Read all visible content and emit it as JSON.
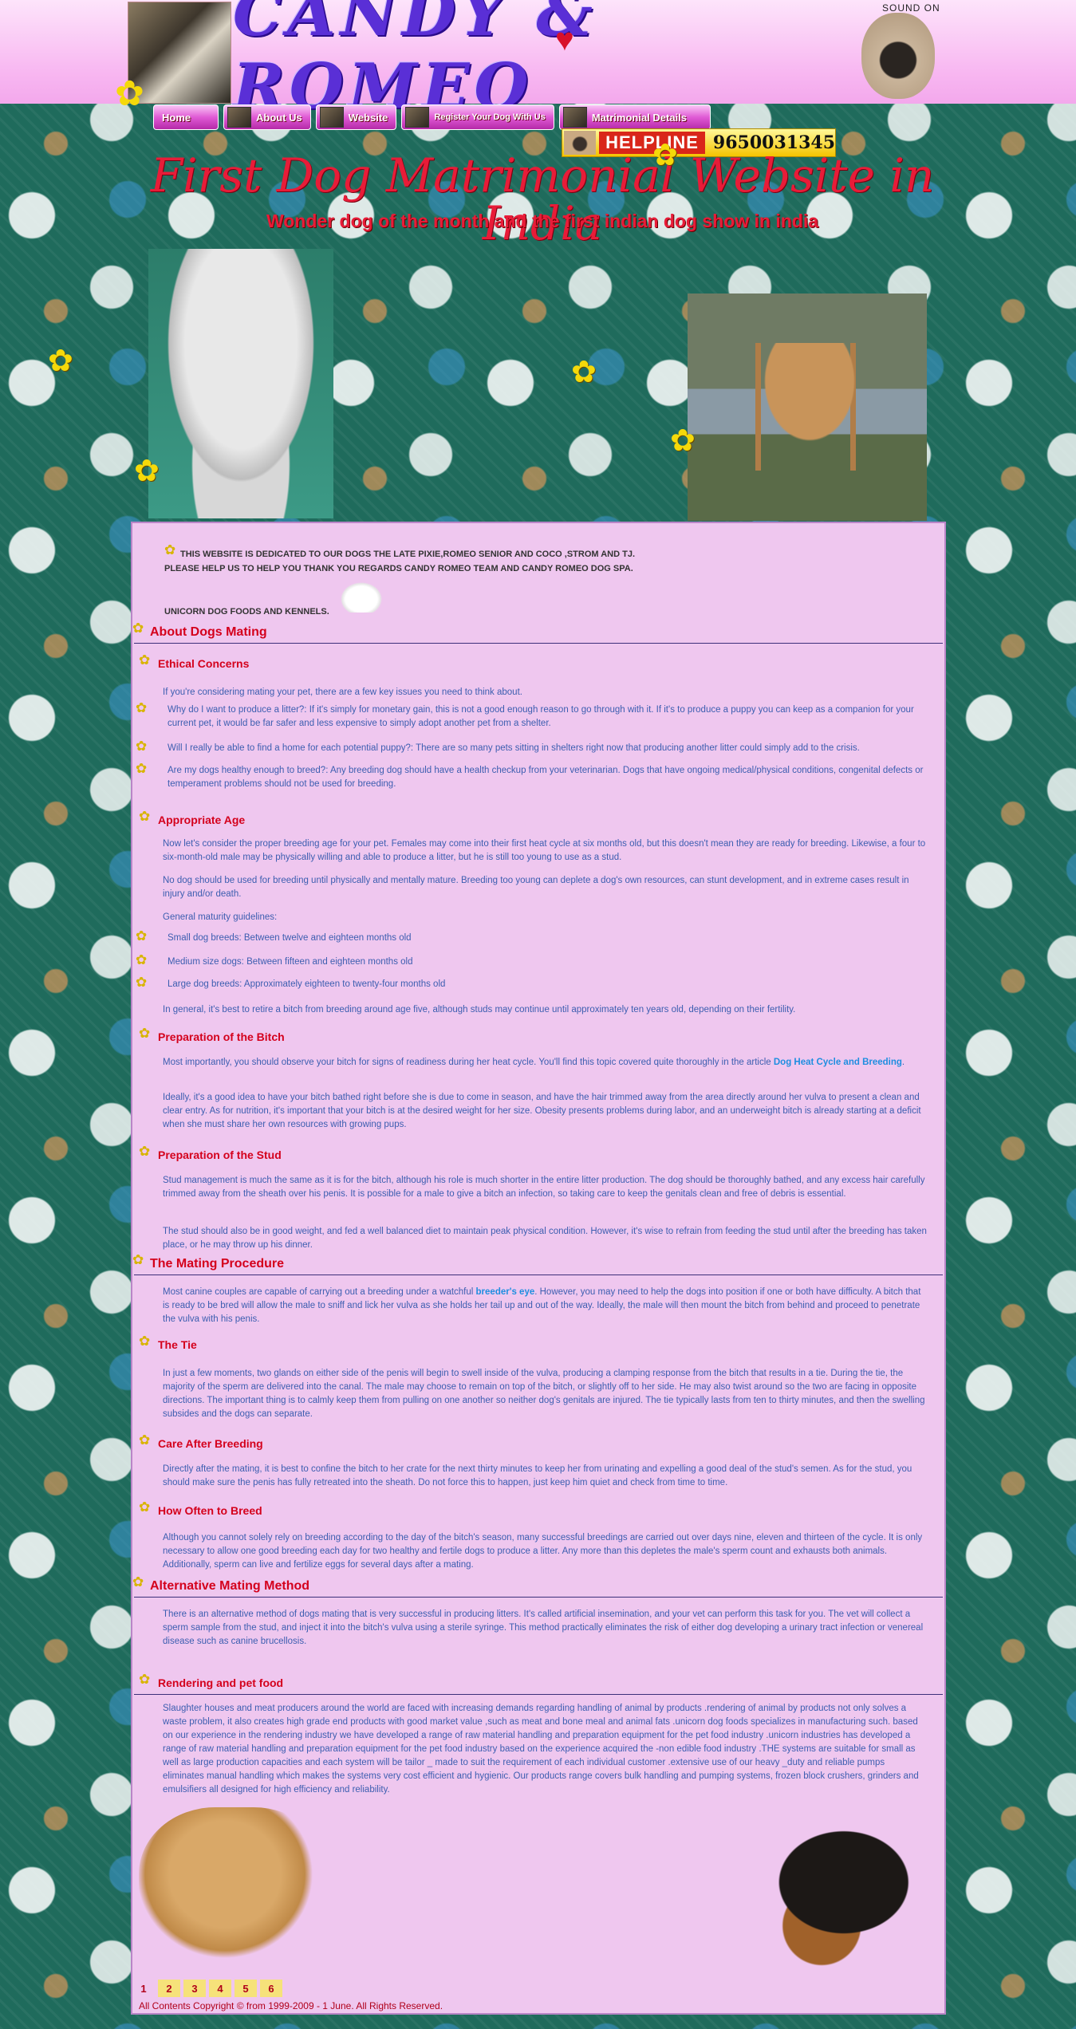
{
  "header": {
    "brand_text": "CANDY & ROMEO",
    "sound_label": "SOUND ON"
  },
  "nav": {
    "items": [
      {
        "label": "Home"
      },
      {
        "label": "About Us"
      },
      {
        "label": "Website"
      },
      {
        "label": "Register Your Dog With Us"
      },
      {
        "label": "Matrimonial Details"
      }
    ]
  },
  "helpline": {
    "label": "HELPLINE",
    "number": "9650031345"
  },
  "hero": {
    "title": "First Dog Matrimonial Website in India",
    "subtitle": "Wonder dog of the month and the first indian dog show in india"
  },
  "intro": {
    "line1": "THIS WEBSITE IS DEDICATED TO OUR DOGS THE LATE PIXIE,ROMEO SENIOR AND COCO ,STROM AND TJ.",
    "line2": "PLEASE HELP US TO HELP YOU THANK YOU REGARDS CANDY ROMEO TEAM AND CANDY ROMEO DOG SPA.",
    "line3": "UNICORN DOG FOODS AND KENNELS."
  },
  "sections": {
    "about_mating": "About Dogs Mating",
    "ethical": {
      "title": "Ethical Concerns",
      "intro": "If you're considering mating your pet, there are a few key issues you need to think about.",
      "q1": "Why do I want to produce a litter?: If it's simply for monetary gain, this is not a good enough reason to go through with it. If it's to produce a puppy you can keep as a companion for your current pet, it would be far safer and less expensive to simply adopt another pet from a shelter.",
      "q2": "Will I really be able to find a home for each potential puppy?: There are so many pets sitting in shelters right now that producing another litter could simply add to the crisis.",
      "q3": "Are my dogs healthy enough to breed?: Any breeding dog should have a health checkup from your veterinarian. Dogs that have ongoing medical/physical conditions, congenital defects or temperament problems should not be used for breeding."
    },
    "age": {
      "title": "Appropriate Age",
      "p1": "Now let's consider the proper breeding age for your pet. Females may come into their first heat cycle at six months old, but this doesn't mean they are ready for breeding. Likewise, a four to six-month-old male may be physically willing and able to produce a litter, but he is still too young to use as a stud.",
      "p2": "No dog should be used for breeding until physically and mentally mature. Breeding too young can deplete a dog's own resources, can stunt development, and in extreme cases result in injury and/or death.",
      "p3": "General maturity guidelines:",
      "g1": "Small dog breeds: Between twelve and eighteen months old",
      "g2": "Medium size dogs: Between fifteen and eighteen months old",
      "g3": "Large dog breeds: Approximately eighteen to twenty-four months old",
      "p4": "In general, it's best to retire a bitch from breeding around age five, although studs may continue until approximately ten years old, depending on their fertility."
    },
    "bitch": {
      "title": "Preparation of the Bitch",
      "p1_pre": "Most importantly, you should observe your bitch for signs of readiness during her heat cycle. You'll find this topic covered quite thoroughly in the article ",
      "p1_link": "Dog Heat Cycle and Breeding",
      "p1_post": ".",
      "p2": "Ideally, it's a good idea to have your bitch bathed right before she is due to come in season, and have the hair trimmed away from the area directly around her vulva to present a clean and clear entry. As for nutrition, it's important that your bitch is at the desired weight for her size. Obesity presents problems during labor, and an underweight bitch is already starting at a deficit when she must share her own resources with growing pups."
    },
    "stud": {
      "title": "Preparation of the Stud",
      "p1": "Stud management is much the same as it is for the bitch, although his role is much shorter in the entire litter production. The dog should be thoroughly bathed, and any excess hair carefully trimmed away from the sheath over his penis. It is possible for a male to give a bitch an infection, so taking care to keep the genitals clean and free of debris is essential.",
      "p2": "The stud should also be in good weight, and fed a well balanced diet to maintain peak physical condition. However, it's wise to refrain from feeding the stud until after the breeding has taken place, or he may throw up his dinner."
    },
    "procedure": {
      "title": "The Mating Procedure",
      "p1_pre": "Most canine couples are capable of carrying out a breeding under a watchful ",
      "p1_link": "breeder's eye",
      "p1_post": ". However, you may need to help the dogs into position if one or both have difficulty. A bitch that is ready to be bred will allow the male to sniff and lick her vulva as she holds her tail up and out of the way. Ideally, the male will then mount the bitch from behind and proceed to penetrate the vulva with his penis."
    },
    "tie": {
      "title": "The Tie",
      "p1": "In just a few moments, two glands on either side of the penis will begin to swell inside of the vulva, producing a clamping response from the bitch that results in a tie. During the tie, the majority of the sperm are delivered into the canal. The male may choose to remain on top of the bitch, or slightly off to her side. He may also twist around so the two are facing in opposite directions. The important thing is to calmly keep them from pulling on one another so neither dog's genitals are injured. The tie typically lasts from ten to thirty minutes, and then the swelling subsides and the dogs can separate."
    },
    "care": {
      "title": "Care After Breeding",
      "p1": "Directly after the mating, it is best to confine the bitch to her crate for the next thirty minutes to keep her from urinating and expelling a good deal of the stud's semen. As for the stud, you should make sure the penis has fully retreated into the sheath. Do not force this to happen, just keep him quiet and check from time to time."
    },
    "often": {
      "title": "How Often to Breed",
      "p1": "Although you cannot solely rely on breeding according to the day of the bitch's season, many successful breedings are carried out over days nine, eleven and thirteen of the cycle. It is only necessary to allow one good breeding each day for two healthy and fertile dogs to produce a litter. Any more than this depletes the male's sperm count and exhausts both animals. Additionally, sperm can live and fertilize eggs for several days after a mating."
    },
    "alt": {
      "title": "Alternative Mating Method",
      "p1": "There is an alternative method of dogs mating that is very successful in producing litters. It's called artificial insemination, and your vet can perform this task for you. The vet will collect a sperm sample from the stud, and inject it into the bitch's vulva using a sterile syringe. This method practically eliminates the risk of either dog developing a urinary tract infection or venereal disease such as canine brucellosis."
    },
    "render": {
      "title": "Rendering and pet food",
      "p1": "Slaughter houses and meat producers around the world are faced with increasing demands regarding handling of animal by products .rendering of animal by products not only solves a waste problem, it also creates high grade end products with good market value ,such as meat and bone meal and animal fats .unicorn dog foods specializes in manufacturing such. based on our experience in the rendering industry we have developed a range of raw material handling and preparation equipment for the pet food industry .unicorn industries has developed a range of raw material handling and preparation equipment for the pet food industry based on the experience acquired the -non edible food industry .THE systems are suitable for small as well as large production capacities and each system will be tailor _ made to suit the requirement of each individual customer .extensive use of our heavy _duty and reliable pumps eliminates manual handling which makes the systems very cost efficient and hygienic. Our products range covers bulk handling and pumping systems, frozen block crushers, grinders and emulsifiers all designed for high efficiency and reliability."
    }
  },
  "pager": {
    "pages": [
      "1",
      "2",
      "3",
      "4",
      "5",
      "6"
    ]
  },
  "footer": {
    "copyright": "All Contents Copyright © from 1999-2009 - 1 June. All Rights Reserved."
  }
}
